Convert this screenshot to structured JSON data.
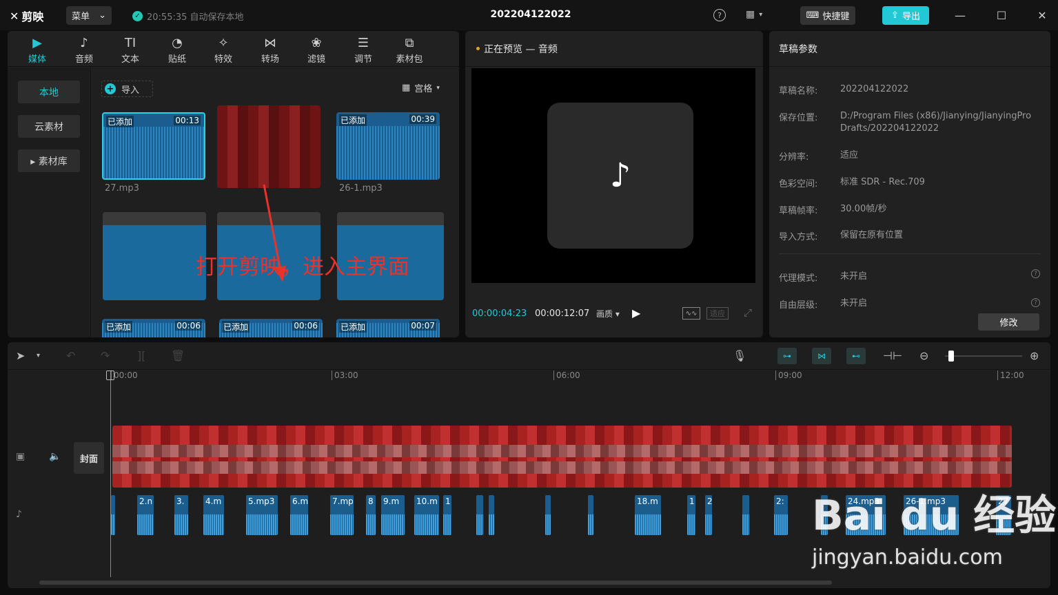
{
  "titlebar": {
    "app_name": "剪映",
    "menu_label": "菜单",
    "autosave_text": "20:55:35 自动保存本地",
    "project_title": "202204122022",
    "help": "?",
    "shortcut_label": "快捷键",
    "export_label": "导出"
  },
  "toolbar": {
    "tools": [
      {
        "label": "媒体",
        "icon": "media-icon",
        "glyph": "▶"
      },
      {
        "label": "音频",
        "icon": "audio-icon",
        "glyph": "♪"
      },
      {
        "label": "文本",
        "icon": "text-icon",
        "glyph": "TI"
      },
      {
        "label": "贴纸",
        "icon": "sticker-icon",
        "glyph": "◔"
      },
      {
        "label": "特效",
        "icon": "effects-icon",
        "glyph": "✧"
      },
      {
        "label": "转场",
        "icon": "transition-icon",
        "glyph": "⋈"
      },
      {
        "label": "滤镜",
        "icon": "filter-icon",
        "glyph": "❀"
      },
      {
        "label": "调节",
        "icon": "adjust-icon",
        "glyph": "☰"
      },
      {
        "label": "素材包",
        "icon": "package-icon",
        "glyph": "⧉"
      }
    ]
  },
  "sidebar": {
    "items": [
      {
        "label": "本地"
      },
      {
        "label": "云素材"
      },
      {
        "label": "▸ 素材库"
      }
    ]
  },
  "media": {
    "import_label": "导入",
    "view_label": "宫格",
    "thumbs": [
      {
        "badge": "已添加",
        "duration": "00:13",
        "name": "27.mp3"
      },
      {
        "badge": "",
        "duration": "",
        "name": ""
      },
      {
        "badge": "已添加",
        "duration": "00:39",
        "name": "26-1.mp3"
      },
      {
        "badge": "已添加",
        "duration": "00:06",
        "name": ""
      },
      {
        "badge": "已添加",
        "duration": "00:06",
        "name": ""
      },
      {
        "badge": "已添加",
        "duration": "00:07",
        "name": ""
      }
    ],
    "annotation": "打开剪映，进入主界面"
  },
  "preview": {
    "header": "正在预览 — 音频",
    "current_time": "00:00:04:23",
    "total_time": "00:00:12:07",
    "quality_label": "画质",
    "fit_label": "适应"
  },
  "params": {
    "header": "草稿参数",
    "rows": [
      {
        "label": "草稿名称:",
        "value": "202204122022"
      },
      {
        "label": "保存位置:",
        "value": "D:/Program Files (x86)/Jianying/JianyingPro Drafts/202204122022"
      },
      {
        "label": "分辨率:",
        "value": "适应"
      },
      {
        "label": "色彩空间:",
        "value": "标准 SDR - Rec.709"
      },
      {
        "label": "草稿帧率:",
        "value": "30.00帧/秒"
      },
      {
        "label": "导入方式:",
        "value": "保留在原有位置"
      },
      {
        "label": "代理模式:",
        "value": "未开启"
      },
      {
        "label": "自由层级:",
        "value": "未开启"
      }
    ],
    "modify_label": "修改"
  },
  "timeline": {
    "ruler": [
      "00:00",
      "03:00",
      "06:00",
      "09:00",
      "12:00"
    ],
    "cover_label": "封面",
    "audio_clips": [
      "",
      "2.n",
      "3.",
      "4.m",
      "5.mp3",
      "6.m",
      "7.mp",
      "8",
      "9.m",
      "10.m",
      "1",
      "",
      "",
      "",
      "",
      "18.m",
      "1",
      "2",
      "",
      "2:",
      "",
      "24.mp3",
      "26-1.mp3",
      "27"
    ]
  },
  "watermark": {
    "main": "Bai du 经验",
    "sub": "jingyan.baidu.com"
  }
}
